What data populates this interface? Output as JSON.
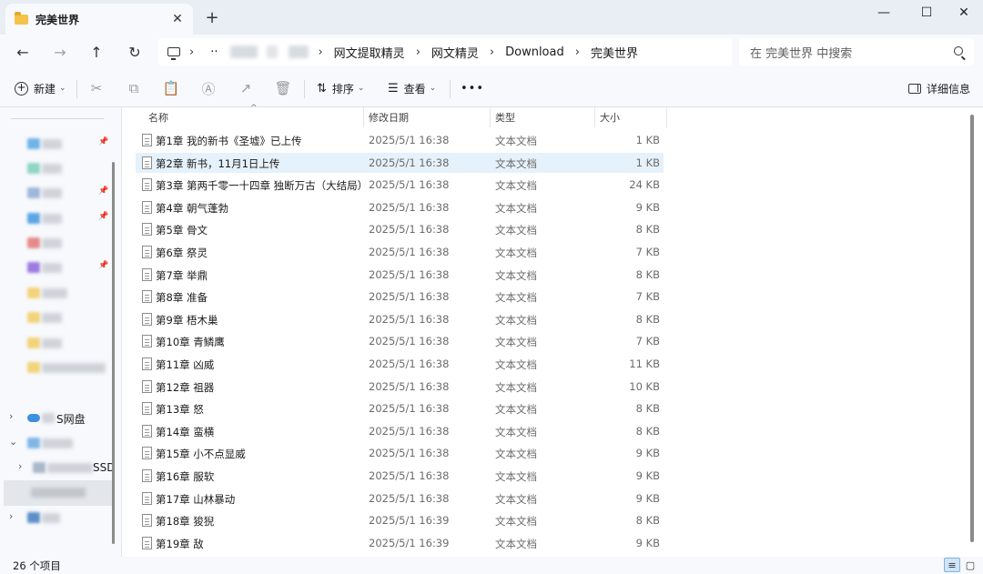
{
  "window": {
    "tab_title": "完美世界",
    "tab_close": "✕",
    "new_tab": "+",
    "minimize": "—",
    "maximize": "☐",
    "close": "✕"
  },
  "nav": {
    "back": "←",
    "forward": "→",
    "up": "↑",
    "refresh": "↻"
  },
  "breadcrumb": {
    "leading_sep": "›",
    "ellipsis": "··",
    "items": [
      "网文提取精灵",
      "网文精灵",
      "Download",
      "完美世界"
    ],
    "separator": "›"
  },
  "search": {
    "placeholder": "在 完美世界 中搜索"
  },
  "commands": {
    "new": "新建",
    "sort": "排序",
    "view": "查看",
    "more": "•••",
    "details": "详细信息",
    "chevron": "⌄"
  },
  "icons": {
    "cut": "✂",
    "copy": "⧉",
    "paste": "📋",
    "rename": "Ⓐ",
    "share": "↗",
    "delete": "🗑"
  },
  "columns": {
    "name": "名称",
    "date": "修改日期",
    "type": "类型",
    "size": "大小",
    "sort_indicator": "^"
  },
  "sidebar": {
    "arrow_collapsed": "›",
    "arrow_expanded": "⌄",
    "pin": "📌",
    "labels": {
      "cloud_suffix": "S网盘",
      "ssd_suffix": "SSD"
    }
  },
  "files": [
    {
      "name": "第1章 我的新书《圣墟》已上传",
      "date": "2025/5/1 16:38",
      "type": "文本文档",
      "size": "1 KB"
    },
    {
      "name": "第2章 新书，11月1日上传",
      "date": "2025/5/1 16:38",
      "type": "文本文档",
      "size": "1 KB"
    },
    {
      "name": "第3章 第两千零一十四章 独断万古（大结局）",
      "date": "2025/5/1 16:38",
      "type": "文本文档",
      "size": "24 KB"
    },
    {
      "name": "第4章 朝气蓬勃",
      "date": "2025/5/1 16:38",
      "type": "文本文档",
      "size": "9 KB"
    },
    {
      "name": "第5章 骨文",
      "date": "2025/5/1 16:38",
      "type": "文本文档",
      "size": "8 KB"
    },
    {
      "name": "第6章 祭灵",
      "date": "2025/5/1 16:38",
      "type": "文本文档",
      "size": "7 KB"
    },
    {
      "name": "第7章 举鼎",
      "date": "2025/5/1 16:38",
      "type": "文本文档",
      "size": "8 KB"
    },
    {
      "name": "第8章 准备",
      "date": "2025/5/1 16:38",
      "type": "文本文档",
      "size": "7 KB"
    },
    {
      "name": "第9章 梧木巢",
      "date": "2025/5/1 16:38",
      "type": "文本文档",
      "size": "8 KB"
    },
    {
      "name": "第10章 青鳞鹰",
      "date": "2025/5/1 16:38",
      "type": "文本文档",
      "size": "7 KB"
    },
    {
      "name": "第11章 凶威",
      "date": "2025/5/1 16:38",
      "type": "文本文档",
      "size": "11 KB"
    },
    {
      "name": "第12章 祖器",
      "date": "2025/5/1 16:38",
      "type": "文本文档",
      "size": "10 KB"
    },
    {
      "name": "第13章 怒",
      "date": "2025/5/1 16:38",
      "type": "文本文档",
      "size": "8 KB"
    },
    {
      "name": "第14章 蛮横",
      "date": "2025/5/1 16:38",
      "type": "文本文档",
      "size": "8 KB"
    },
    {
      "name": "第15章 小不点显威",
      "date": "2025/5/1 16:38",
      "type": "文本文档",
      "size": "9 KB"
    },
    {
      "name": "第16章 服软",
      "date": "2025/5/1 16:38",
      "type": "文本文档",
      "size": "9 KB"
    },
    {
      "name": "第17章 山林暴动",
      "date": "2025/5/1 16:38",
      "type": "文本文档",
      "size": "9 KB"
    },
    {
      "name": "第18章 狻猊",
      "date": "2025/5/1 16:39",
      "type": "文本文档",
      "size": "8 KB"
    },
    {
      "name": "第19章 敌",
      "date": "2025/5/1 16:39",
      "type": "文本文档",
      "size": "9 KB"
    }
  ],
  "selected_index": 1,
  "status": {
    "item_count": "26 个项目"
  },
  "colors": {
    "selection": "#e5f1fb",
    "folder": "#f3c34a",
    "chrome": "#f7f9fc"
  }
}
